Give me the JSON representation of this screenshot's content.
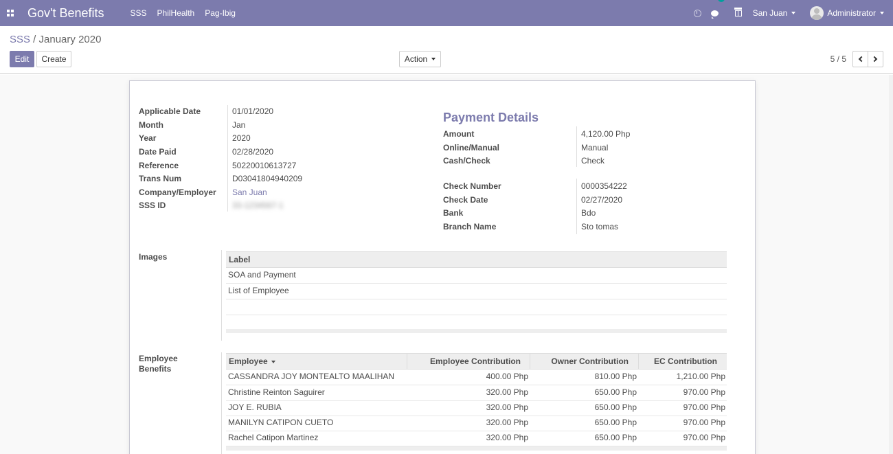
{
  "navbar": {
    "brand": "Gov't Benefits",
    "menu": [
      "SSS",
      "PhilHealth",
      "Pag-Ibig"
    ],
    "chat_count": "1",
    "company": "San Juan",
    "user": "Administrator",
    "accent_color": "#7c7bad"
  },
  "breadcrumb": {
    "parent": "SSS",
    "separator": " / ",
    "current": "January 2020"
  },
  "buttons": {
    "edit": "Edit",
    "create": "Create",
    "action": "Action"
  },
  "pager": "5 / 5",
  "fields": {
    "applicable_date": {
      "label": "Applicable Date",
      "value": "01/01/2020"
    },
    "month": {
      "label": "Month",
      "value": "Jan"
    },
    "year": {
      "label": "Year",
      "value": "2020"
    },
    "date_paid": {
      "label": "Date Paid",
      "value": "02/28/2020"
    },
    "reference": {
      "label": "Reference",
      "value": "50220010613727"
    },
    "trans_num": {
      "label": "Trans Num",
      "value": "D03041804940209"
    },
    "company": {
      "label": "Company/Employer",
      "value": "San Juan"
    },
    "sss_id": {
      "label": "SSS ID",
      "value": "33-1234567-1"
    }
  },
  "payment": {
    "title": "Payment Details",
    "amount": {
      "label": "Amount",
      "value": "4,120.00 Php"
    },
    "online_manual": {
      "label": "Online/Manual",
      "value": "Manual"
    },
    "cash_check": {
      "label": "Cash/Check",
      "value": "Check"
    },
    "check_number": {
      "label": "Check Number",
      "value": "0000354222"
    },
    "check_date": {
      "label": "Check Date",
      "value": "02/27/2020"
    },
    "bank": {
      "label": "Bank",
      "value": "Bdo"
    },
    "branch": {
      "label": "Branch Name",
      "value": "Sto tomas"
    }
  },
  "images": {
    "label": "Images",
    "header": "Label",
    "rows": [
      "SOA and Payment",
      "List of Employee"
    ]
  },
  "benefits": {
    "label_line1": "Employee",
    "label_line2": "Benefits",
    "headers": {
      "employee": "Employee",
      "employee_contribution": "Employee Contribution",
      "owner_contribution": "Owner Contribution",
      "ec_contribution": "EC Contribution"
    },
    "rows": [
      {
        "employee": "CASSANDRA JOY MONTEALTO MAALIHAN",
        "employee_contribution": "400.00 Php",
        "owner_contribution": "810.00 Php",
        "ec_contribution": "1,210.00 Php"
      },
      {
        "employee": "Christine Reinton Saguirer",
        "employee_contribution": "320.00 Php",
        "owner_contribution": "650.00 Php",
        "ec_contribution": "970.00 Php"
      },
      {
        "employee": "JOY E. RUBIA",
        "employee_contribution": "320.00 Php",
        "owner_contribution": "650.00 Php",
        "ec_contribution": "970.00 Php"
      },
      {
        "employee": "MANILYN CATIPON CUETO",
        "employee_contribution": "320.00 Php",
        "owner_contribution": "650.00 Php",
        "ec_contribution": "970.00 Php"
      },
      {
        "employee": "Rachel Catipon Martinez",
        "employee_contribution": "320.00 Php",
        "owner_contribution": "650.00 Php",
        "ec_contribution": "970.00 Php"
      }
    ]
  }
}
